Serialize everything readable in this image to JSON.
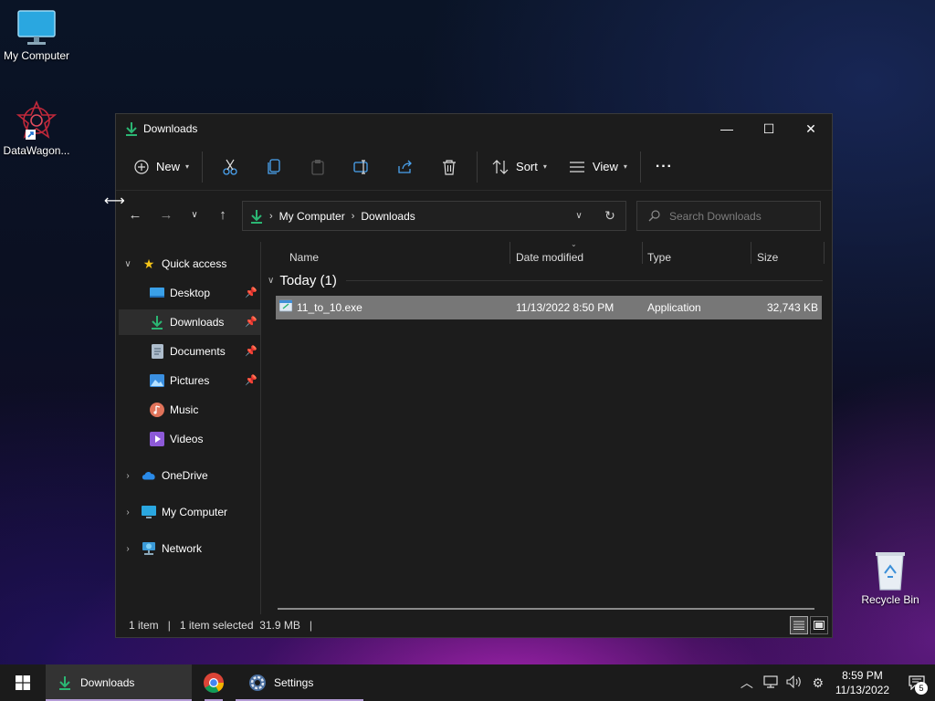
{
  "desktop": {
    "icons": [
      {
        "label": "My Computer",
        "icon": "monitor-icon"
      },
      {
        "label": "DataWagon...",
        "icon": "datawagon-shortcut-icon"
      },
      {
        "label": "Recycle Bin",
        "icon": "recycle-bin-icon"
      }
    ]
  },
  "window": {
    "title": "Downloads",
    "controls": {
      "minimize": "—",
      "maximize": "☐",
      "close": "✕"
    }
  },
  "toolbar": {
    "new_label": "New",
    "sort_label": "Sort",
    "view_label": "View",
    "more_label": "···",
    "icons": [
      "new-icon",
      "cut-icon",
      "copy-icon",
      "paste-icon",
      "rename-icon",
      "share-icon",
      "delete-icon",
      "sort-icon",
      "view-icon",
      "more-icon"
    ]
  },
  "address": {
    "crumbs": [
      "My Computer",
      "Downloads"
    ],
    "search_placeholder": "Search Downloads"
  },
  "sidebar": {
    "quick_access": "Quick access",
    "items": [
      {
        "label": "Desktop",
        "pinned": true
      },
      {
        "label": "Downloads",
        "pinned": true,
        "selected": true
      },
      {
        "label": "Documents",
        "pinned": true
      },
      {
        "label": "Pictures",
        "pinned": true
      },
      {
        "label": "Music",
        "pinned": false
      },
      {
        "label": "Videos",
        "pinned": false
      }
    ],
    "onedrive": "OneDrive",
    "my_computer": "My Computer",
    "network": "Network"
  },
  "files": {
    "columns": [
      "Name",
      "Date modified",
      "Type",
      "Size"
    ],
    "group": "Today (1)",
    "rows": [
      {
        "name": "11_to_10.exe",
        "date": "11/13/2022 8:50 PM",
        "type": "Application",
        "size": "32,743 KB"
      }
    ]
  },
  "status": {
    "count": "1 item",
    "selected": "1 item selected  31.9 MB"
  },
  "taskbar": {
    "apps": [
      {
        "label": "Downloads",
        "active": true
      },
      {
        "label": "",
        "icon": "chrome-icon"
      },
      {
        "label": "Settings"
      }
    ],
    "time": "8:59 PM",
    "date": "11/13/2022",
    "notifications": "5"
  },
  "colors": {
    "accent_download": "#2bb673",
    "selected_row": "#777777",
    "window_bg": "#1c1c1c",
    "taskbar_bg": "#1b1b1b"
  }
}
